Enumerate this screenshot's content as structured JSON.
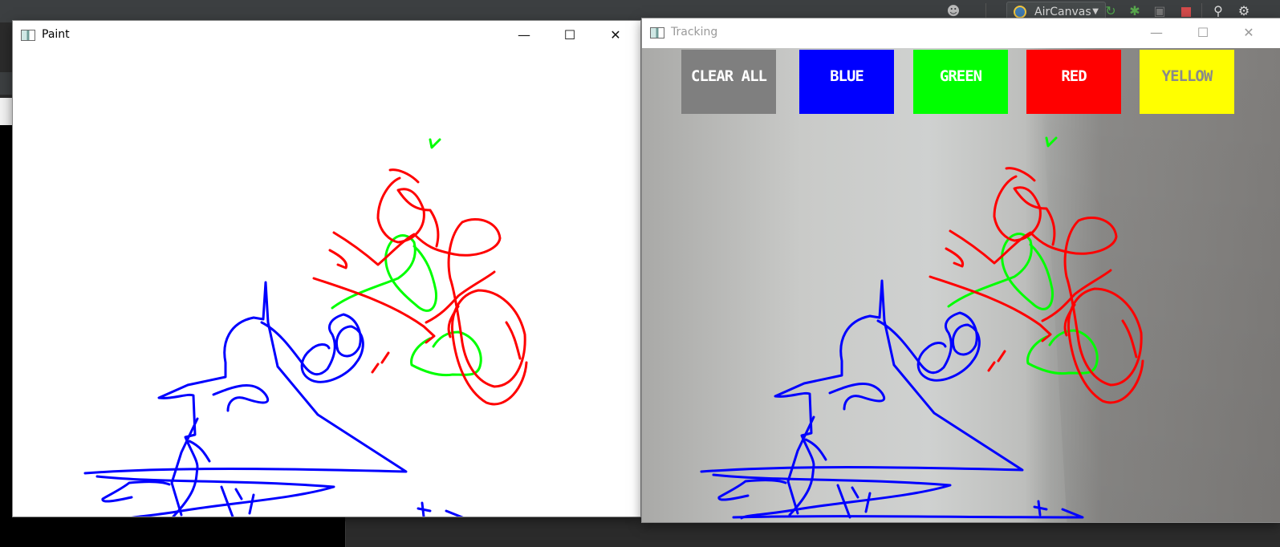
{
  "ide": {
    "run_config": "AirCanvas",
    "icons": [
      "user-icon",
      "rerun-icon",
      "debug-icon",
      "profile-icon",
      "stop-icon",
      "search-icon",
      "settings-icon"
    ]
  },
  "paint_window": {
    "title": "Paint",
    "controls": {
      "minimize": "—",
      "maximize": "☐",
      "close": "✕"
    }
  },
  "tracking_window": {
    "title": "Tracking",
    "controls": {
      "minimize": "—",
      "maximize": "☐",
      "close": "✕"
    },
    "buttons": [
      {
        "label": "CLEAR ALL",
        "bg": "#7f7f7f",
        "fg": "#ffffff"
      },
      {
        "label": "BLUE",
        "bg": "#0000ff",
        "fg": "#ffffff"
      },
      {
        "label": "GREEN",
        "bg": "#00ff00",
        "fg": "#ffffff"
      },
      {
        "label": "RED",
        "bg": "#ff0000",
        "fg": "#ffffff"
      },
      {
        "label": "YELLOW",
        "bg": "#ffff00",
        "fg": "#8a8a8a"
      }
    ]
  },
  "stroke_colors": {
    "blue": "#0000ff",
    "green": "#00ff00",
    "red": "#ff0000"
  }
}
